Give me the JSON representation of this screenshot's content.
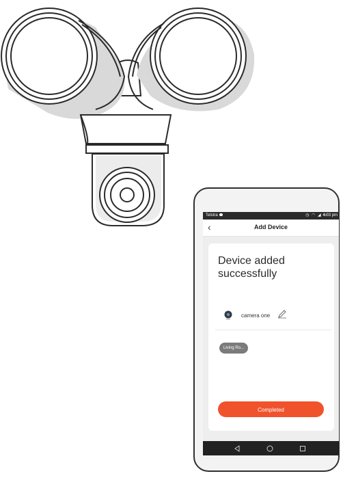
{
  "status_bar": {
    "carrier": "Telstra",
    "time": "4:03 pm"
  },
  "app_bar": {
    "back_icon": "chevron-left-icon",
    "title": "Add Device"
  },
  "result": {
    "headline": "Device added successfully"
  },
  "device": {
    "name": "camera one",
    "thumbnail_icon": "camera-thumbnail-icon",
    "edit_icon": "pencil-icon"
  },
  "room_chip": {
    "label": "Living Ro..."
  },
  "actions": {
    "completed_label": "Completed"
  },
  "nav_bar": {
    "buttons": [
      "back-triangle-icon",
      "home-circle-icon",
      "recents-square-icon"
    ]
  },
  "colors": {
    "accent": "#f0522c",
    "status_bar": "#2b2b2b",
    "nav_bar": "#222222",
    "chip": "#7b7b7b"
  }
}
